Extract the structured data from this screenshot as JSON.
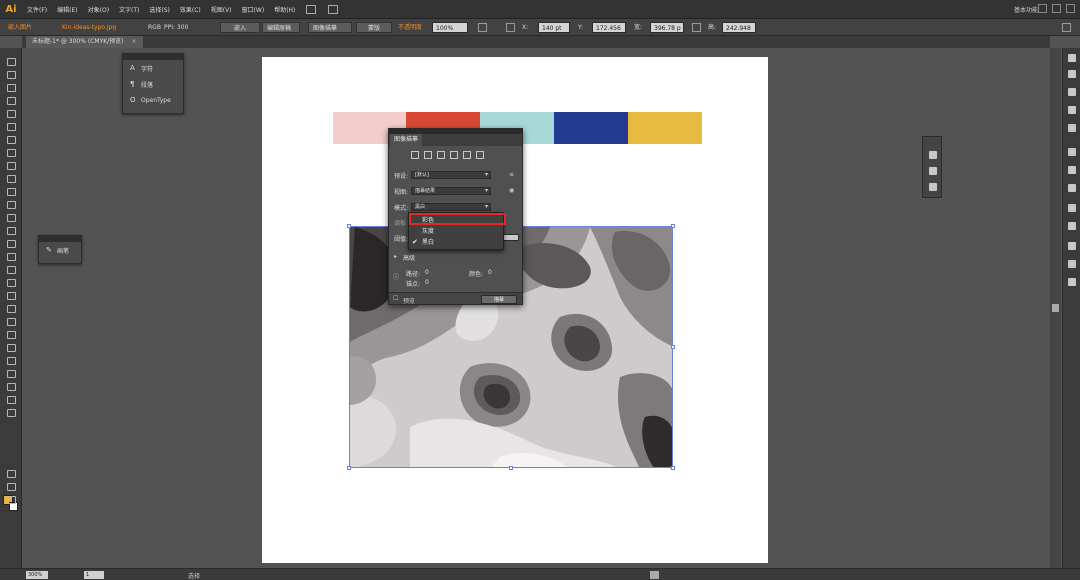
{
  "app": {
    "logo": "Ai",
    "workspace": "基本功能"
  },
  "menubar": {
    "items": [
      "文件(F)",
      "编辑(E)",
      "对象(O)",
      "文字(T)",
      "选择(S)",
      "效果(C)",
      "视图(V)",
      "窗口(W)",
      "帮助(H)"
    ]
  },
  "controlbar": {
    "embed_label": "嵌入图片",
    "filename": "Kin-ideas-typo.jpg",
    "colormode": "RGB",
    "ppi": "PPI: 300",
    "embed_btn": "嵌入",
    "edit_orig_btn": "编辑原稿",
    "image_trace_btn": "图像描摹",
    "mask_btn": "蒙版",
    "opacity_label": "不透明度",
    "opacity_value": "100%",
    "x_value": "140 pt",
    "y_value": "172.456",
    "w_value": "396.78 p",
    "h_value": "242.948"
  },
  "document": {
    "tab_title": "未标题-1* @ 300% (CMYK/预览)",
    "close": "×"
  },
  "statusbar": {
    "zoom": "300%",
    "page": "1",
    "mode": "选择"
  },
  "colors": {
    "bar_colors": [
      "#f2cdcc",
      "#d94833",
      "#a9d8d8",
      "#243a91",
      "#e6bb3f"
    ],
    "fill_swatch": "#e8b640",
    "highlight": "#e02b25"
  },
  "char_panel": {
    "items": [
      {
        "icon": "A",
        "label": "字符"
      },
      {
        "icon": "¶",
        "label": "段落"
      },
      {
        "icon": "O",
        "label": "OpenType"
      }
    ]
  },
  "swatch_panel": {
    "label": "画笔"
  },
  "trace_panel": {
    "title": "图像描摹",
    "preset_label": "预设:",
    "preset_value": "[默认]",
    "view_label": "视图:",
    "view_value": "描摹结果",
    "mode_label": "模式:",
    "mode_value": "黑白",
    "palette_label": "调板:",
    "threshold_label": "阈值:",
    "advanced_label": "高级",
    "paths_label": "路径:",
    "paths_value": "0",
    "anchors_label": "锚点:",
    "anchors_value": "0",
    "colors_label": "颜色:",
    "colors_value": "0",
    "preview_label": "预览",
    "trace_button": "描摹"
  },
  "mode_dropdown": {
    "options": [
      {
        "label": "彩色",
        "checked": false
      },
      {
        "label": "灰度",
        "checked": false
      },
      {
        "label": "黑白",
        "checked": true
      }
    ]
  }
}
